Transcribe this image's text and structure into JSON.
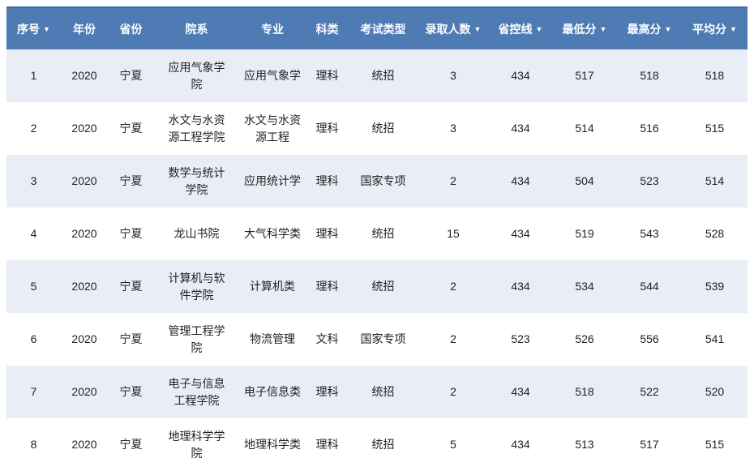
{
  "table": {
    "columns": [
      {
        "key": "index",
        "label": "序号",
        "sortable": true
      },
      {
        "key": "year",
        "label": "年份",
        "sortable": false
      },
      {
        "key": "province",
        "label": "省份",
        "sortable": false
      },
      {
        "key": "department",
        "label": "院系",
        "sortable": false
      },
      {
        "key": "major",
        "label": "专业",
        "sortable": false
      },
      {
        "key": "subject_type",
        "label": "科类",
        "sortable": false
      },
      {
        "key": "exam_type",
        "label": "考试类型",
        "sortable": false
      },
      {
        "key": "admitted_count",
        "label": "录取人数",
        "sortable": true
      },
      {
        "key": "province_control_line",
        "label": "省控线",
        "sortable": true
      },
      {
        "key": "min_score",
        "label": "最低分",
        "sortable": true
      },
      {
        "key": "max_score",
        "label": "最高分",
        "sortable": true
      },
      {
        "key": "avg_score",
        "label": "平均分",
        "sortable": true
      }
    ],
    "rows": [
      [
        "1",
        "2020",
        "宁夏",
        "应用气象学院",
        "应用气象学",
        "理科",
        "统招",
        "3",
        "434",
        "517",
        "518",
        "518"
      ],
      [
        "2",
        "2020",
        "宁夏",
        "水文与水资源工程学院",
        "水文与水资源工程",
        "理科",
        "统招",
        "3",
        "434",
        "514",
        "516",
        "515"
      ],
      [
        "3",
        "2020",
        "宁夏",
        "数学与统计学院",
        "应用统计学",
        "理科",
        "国家专项",
        "2",
        "434",
        "504",
        "523",
        "514"
      ],
      [
        "4",
        "2020",
        "宁夏",
        "龙山书院",
        "大气科学类",
        "理科",
        "统招",
        "15",
        "434",
        "519",
        "543",
        "528"
      ],
      [
        "5",
        "2020",
        "宁夏",
        "计算机与软件学院",
        "计算机类",
        "理科",
        "统招",
        "2",
        "434",
        "534",
        "544",
        "539"
      ],
      [
        "6",
        "2020",
        "宁夏",
        "管理工程学院",
        "物流管理",
        "文科",
        "国家专项",
        "2",
        "523",
        "526",
        "556",
        "541"
      ],
      [
        "7",
        "2020",
        "宁夏",
        "电子与信息工程学院",
        "电子信息类",
        "理科",
        "统招",
        "2",
        "434",
        "518",
        "522",
        "520"
      ],
      [
        "8",
        "2020",
        "宁夏",
        "地理科学学院",
        "地理科学类",
        "理科",
        "统招",
        "5",
        "434",
        "513",
        "517",
        "515"
      ]
    ]
  },
  "icons": {
    "sort_arrow": "▼"
  },
  "colors": {
    "header_bg": "#4f7bb4",
    "header_top_border": "#40699f",
    "header_text": "#ffffff",
    "stripe_bg": "#e9edf6",
    "row_bg": "#ffffff",
    "body_text": "#222222"
  }
}
